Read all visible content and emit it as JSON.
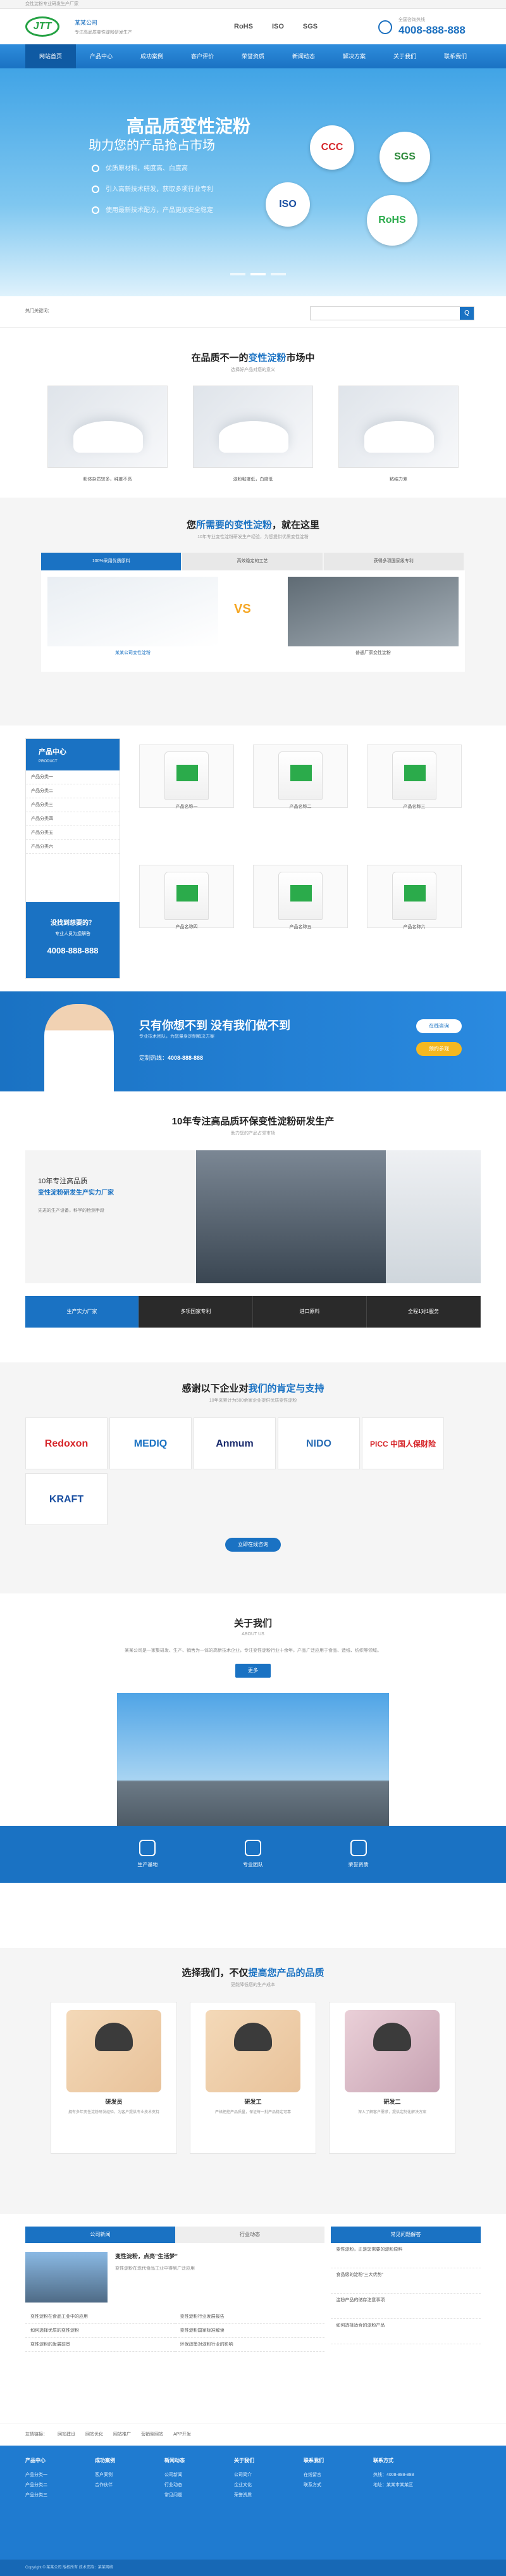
{
  "topbar": {
    "text": "变性淀粉专业研发生产厂家"
  },
  "header": {
    "logo": "JTT",
    "company": "某某公司",
    "slogan": "专注高品质变性淀粉研发生产",
    "cert1": "RoHS",
    "cert2": "ISO",
    "cert3": "SGS",
    "hotline_label": "全国咨询热线",
    "hotline": "4008-888-888"
  },
  "nav": [
    "网站首页",
    "产品中心",
    "成功案例",
    "客户评价",
    "荣誉资质",
    "新闻动态",
    "解决方案",
    "关于我们",
    "联系我们"
  ],
  "banner": {
    "title": "高品质变性淀粉",
    "subtitle": "助力您的产品抢占市场",
    "points": [
      "优质原材料，纯度高、白度高",
      "引入高新技术研发，获取多项行业专利",
      "使用最新技术配方，产品更加安全稳定"
    ],
    "seals": [
      "CCC",
      "ISO",
      "SGS",
      "RoHS"
    ]
  },
  "search": {
    "hot": "热门关键词：",
    "placeholder": "请输入搜索关键词",
    "btn": "Q"
  },
  "sec1": {
    "title_a": "在品质不一的",
    "title_b": "变性淀粉",
    "title_c": "市场中",
    "sub": "选择好产品对您的意义",
    "items": [
      "粉体杂质较多，纯度不高",
      "淀粉粘度低，白度低",
      "粘结力差"
    ]
  },
  "sec2": {
    "title_a": "您",
    "title_b": "所需要的变性淀粉",
    "title_c": "，就在这里",
    "sub": "10年专业变性淀粉研发生产经验，为您提供优质变性淀粉",
    "tabs": [
      "100%采用优质原料",
      "高效稳定的工艺",
      "获得多项国家级专利"
    ],
    "left_cap": "某某公司变性淀粉",
    "right_cap": "普通厂家变性淀粉",
    "vs": "VS"
  },
  "products": {
    "side_title": "产品中心",
    "side_sub": "PRODUCT",
    "cats": [
      "产品分类一",
      "产品分类二",
      "产品分类三",
      "产品分类四",
      "产品分类五",
      "产品分类六"
    ],
    "q": "没找到想要的？",
    "q2": "专业人员为您解答",
    "phone": "4008-888-888",
    "items": [
      "产品名称一",
      "产品名称二",
      "产品名称三",
      "产品名称四",
      "产品名称五",
      "产品名称六"
    ]
  },
  "cta": {
    "title": "只有你想不到 没有我们做不到",
    "sub": "专业技术团队，为您量身定制解决方案",
    "phone_label": "定制热线：",
    "phone": "4008-888-888",
    "b1": "在线咨询",
    "b2": "预约参观"
  },
  "factory": {
    "title": "10年专注高品质环保变性淀粉研发生产",
    "sub": "助力您的产品占领市场",
    "line1": "10年专注高品质",
    "line2": "变性淀粉研发生产实力厂家",
    "desc": "先进的生产设备，科学的检测手段",
    "tabs": [
      "生产实力厂家",
      "多项国家专利",
      "进口原料",
      "全程1对1服务"
    ]
  },
  "partners": {
    "title_a": "感谢以下企业对",
    "title_b": "我们的肯定与支持",
    "sub": "10年来累计为500余家企业提供优质变性淀粉",
    "logos": [
      "Redoxon",
      "MEDIQ",
      "Anmum",
      "NIDO",
      "PICC 中国人保财险",
      "KRAFT"
    ],
    "btn": "立即在线咨询"
  },
  "about": {
    "title": "关于我们",
    "sub": "ABOUT US",
    "text": "某某公司是一家集研发、生产、销售为一体的高新技术企业，专注变性淀粉行业十余年，产品广泛应用于食品、造纸、纺织等领域。",
    "btn": "更多",
    "icons": [
      "生产基地",
      "专业团队",
      "荣誉资质"
    ]
  },
  "team": {
    "title_a": "选择我们，不仅",
    "title_b": "提高您产品的品质",
    "sub": "更能降低您的生产成本",
    "members": [
      {
        "name": "研发员",
        "desc": "拥有多年变性淀粉研发经验，为客户提供专业技术支持"
      },
      {
        "name": "研发工",
        "desc": "严格把控产品质量，保证每一批产品稳定可靠"
      },
      {
        "name": "研发二",
        "desc": "深入了解客户需求，提供定制化解决方案"
      }
    ]
  },
  "news": {
    "tab1": "公司新闻",
    "tab2": "行业动态",
    "tab3": "常见问题解答",
    "headline": "变性淀粉，点亮”生活梦”",
    "headline_desc": "变性淀粉在现代食品工业中得到广泛应用",
    "list1": [
      "变性淀粉在食品工业中的应用",
      "如何选择优质的变性淀粉",
      "变性淀粉的发展前景"
    ],
    "list2": [
      "变性淀粉行业发展报告",
      "变性淀粉国家标准解读",
      "环保政策对淀粉行业的影响"
    ],
    "faq": [
      "变性淀粉，正是您需要的淀粉原料",
      "食品级的淀粉”三大优势”",
      "淀粉产品的储存注意事项",
      "如何选择适合的淀粉产品"
    ]
  },
  "links": {
    "label": "友情链接：",
    "items": [
      "网站建设",
      "网站优化",
      "网站推广",
      "营销型网站",
      "APP开发"
    ]
  },
  "footer": {
    "cols": [
      {
        "t": "产品中心",
        "i": [
          "产品分类一",
          "产品分类二",
          "产品分类三"
        ]
      },
      {
        "t": "成功案例",
        "i": [
          "客户案例",
          "合作伙伴"
        ]
      },
      {
        "t": "新闻动态",
        "i": [
          "公司新闻",
          "行业动态",
          "常见问题"
        ]
      },
      {
        "t": "关于我们",
        "i": [
          "公司简介",
          "企业文化",
          "荣誉资质"
        ]
      },
      {
        "t": "联系我们",
        "i": [
          "在线留言",
          "联系方式"
        ]
      },
      {
        "t": "联系方式",
        "i": [
          "热线：4008-888-888",
          "地址：某某市某某区"
        ]
      }
    ],
    "copy": "Copyright © 某某公司 版权所有 技术支持：某某网络"
  }
}
